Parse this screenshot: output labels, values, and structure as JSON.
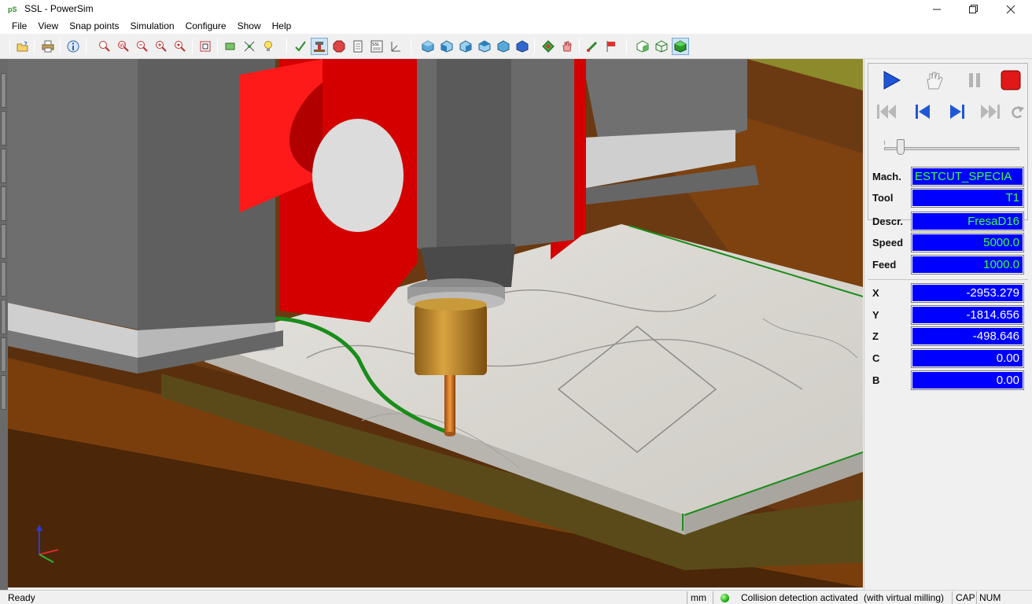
{
  "window": {
    "title": "SSL - PowerSim",
    "app_icon_text": "PS"
  },
  "menu": [
    "File",
    "View",
    "Snap points",
    "Simulation",
    "Configure",
    "Show",
    "Help"
  ],
  "toolbar": {
    "icons": [
      "open-icon",
      "print-icon",
      "info-icon",
      "zoom-window-icon",
      "zoom-all-icon",
      "zoom-out-icon",
      "zoom-in-icon",
      "zoom-dynamic-icon",
      "fit-icon",
      "rectangle-icon",
      "snap-icon",
      "light-icon",
      "check-icon",
      "machine-icon",
      "stop-sign-icon",
      "report-icon",
      "ssl-icon",
      "axes-icon",
      "view-iso-icon",
      "view-front-icon",
      "view-left-icon",
      "view-right-icon",
      "view-back-icon",
      "view-top-icon",
      "rotate-icon",
      "hand-icon",
      "edit-icon",
      "flag-icon",
      "shaded-icon",
      "wireframe-icon",
      "solid-icon"
    ]
  },
  "panel": {
    "controls": {
      "play": "play-icon",
      "hand": "hand-icon",
      "pause": "pause-icon",
      "stop": "stop-icon",
      "first": "first-icon",
      "prev": "previous-icon",
      "next": "next-icon",
      "last": "last-icon",
      "reset": "reset-icon",
      "slider_position": 0.1
    },
    "info": [
      {
        "label": "Mach.",
        "value": "ESTCUT_SPECIA"
      },
      {
        "label": "Tool",
        "value": "T1"
      },
      {
        "label": "Descr.",
        "value": "FresaD16"
      },
      {
        "label": "Speed",
        "value": "5000.0"
      },
      {
        "label": "Feed",
        "value": "1000.0"
      }
    ],
    "coords": [
      {
        "label": "X",
        "value": "-2953.279"
      },
      {
        "label": "Y",
        "value": "-1814.656"
      },
      {
        "label": "Z",
        "value": "-498.646"
      },
      {
        "label": "C",
        "value": "0.00"
      },
      {
        "label": "B",
        "value": "0.00"
      }
    ]
  },
  "statusbar": {
    "ready": "Ready",
    "units": "mm",
    "collision": "Collision detection activated",
    "milling": "(with virtual milling)",
    "cap": "CAP",
    "num": "NUM"
  },
  "colors": {
    "field_bg": "#0000ff",
    "field_text": "#3cff3c",
    "machine_red": "#e00000",
    "toolpath": "#1a8c1a",
    "table_brown": "#7a3e0c"
  }
}
